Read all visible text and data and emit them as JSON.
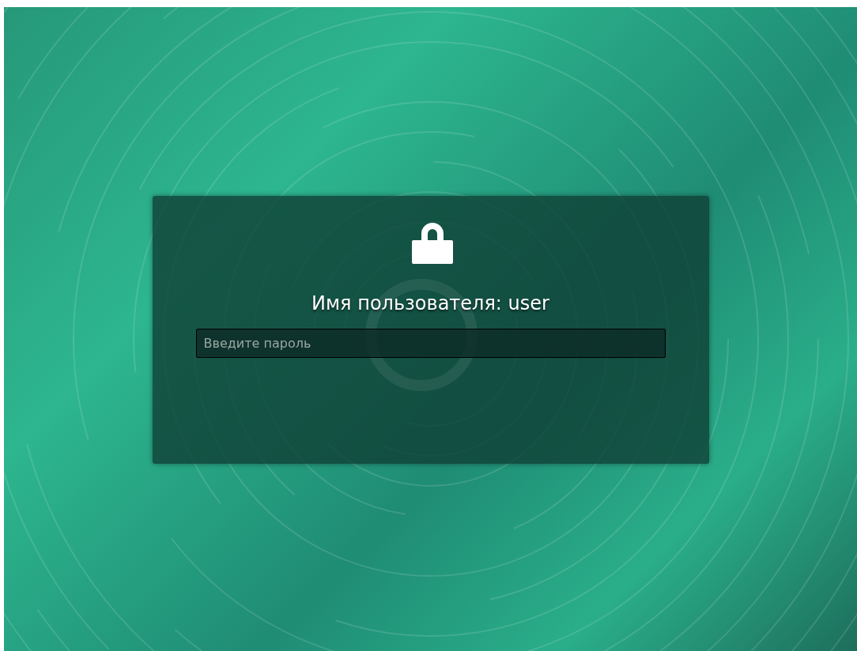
{
  "lock_dialog": {
    "title": "Имя пользователя: user",
    "password_field": {
      "placeholder": "Введите пароль"
    }
  }
}
